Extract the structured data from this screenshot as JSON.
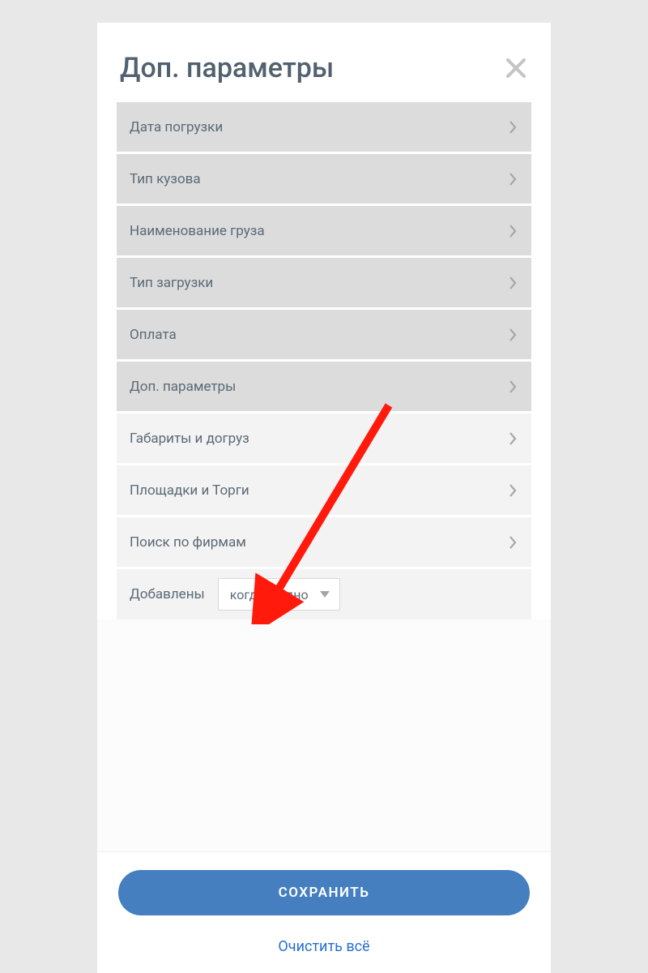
{
  "header": {
    "title": "Доп. параметры"
  },
  "rows": [
    {
      "label": "Дата погрузки",
      "style": "dark"
    },
    {
      "label": "Тип кузова",
      "style": "dark"
    },
    {
      "label": "Наименование груза",
      "style": "dark"
    },
    {
      "label": "Тип загрузки",
      "style": "dark"
    },
    {
      "label": "Оплата",
      "style": "dark"
    },
    {
      "label": "Доп. параметры",
      "style": "dark"
    },
    {
      "label": "Габариты и догруз",
      "style": "light"
    },
    {
      "label": "Площадки и Торги",
      "style": "light"
    },
    {
      "label": "Поиск по фирмам",
      "style": "light"
    }
  ],
  "added": {
    "label": "Добавлены",
    "select_value": "когда угодно"
  },
  "footer": {
    "save_label": "СОХРАНИТЬ",
    "clear_label": "Очистить всё"
  },
  "colors": {
    "primary": "#457fbf",
    "link": "#2771d0",
    "arrow": "#ff1a0c"
  }
}
